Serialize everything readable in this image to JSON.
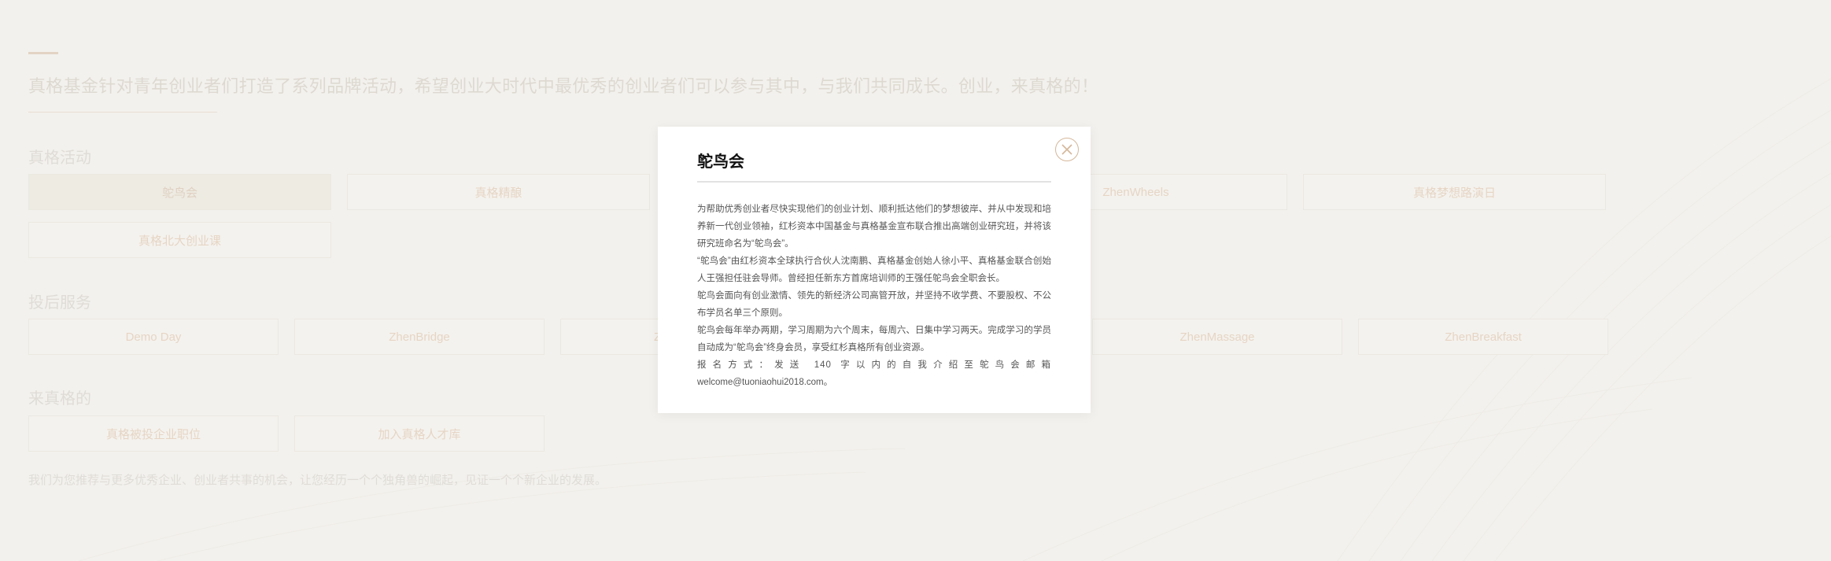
{
  "intro": {
    "text": "真格基金针对青年创业者们打造了系列品牌活动，希望创业大时代中最优秀的创业者们可以参与其中，与我们共同成长。创业，来真格的！"
  },
  "activities": {
    "title": "真格活动",
    "items": [
      "鸵鸟会",
      "真格精酿",
      "",
      "ZhenWheels",
      "真格梦想路演日",
      "真格北大创业课"
    ]
  },
  "post_investment": {
    "title": "投后服务",
    "items": [
      "Demo Day",
      "ZhenBridge",
      "Z",
      "ZhenMassage",
      "ZhenBreakfast"
    ]
  },
  "join": {
    "title": "来真格的",
    "items": [
      "真格被投企业职位",
      "加入真格人才库"
    ],
    "note": "我们为您推荐与更多优秀企业、创业者共事的机会，让您经历一个个独角兽的崛起，见证一个个新企业的发展。"
  },
  "modal": {
    "title": "鸵鸟会",
    "close_icon": "close-icon",
    "paragraphs": [
      "为帮助优秀创业者尽快实现他们的创业计划、顺利抵达他们的梦想彼岸、并从中发现和培养新一代创业领袖，红杉资本中国基金与真格基金宣布联合推出高端创业研究班，并将该研究班命名为“鸵鸟会”。",
      "“鸵鸟会”由红杉资本全球执行合伙人沈南鹏、真格基金创始人徐小平、真格基金联合创始人王强担任驻会导师。曾经担任新东方首席培训师的王强任鸵鸟会全职会长。",
      "鸵鸟会面向有创业激情、领先的新经济公司高管开放，并坚持不收学费、不要股权、不公布学员名单三个原则。",
      "鸵鸟会每年举办两期，学习周期为六个周末，每周六、日集中学习两天。完成学习的学员自动成为“鸵鸟会”终身会员，享受红杉真格所有创业资源。"
    ],
    "signup": "报名方式：发送 140 字以内的自我介绍至鸵鸟会邮箱",
    "email": "welcome@tuoniaohui2018.com。"
  },
  "colors": {
    "background": "#f3f1ec",
    "accent": "#d5b79a",
    "muted_text": "#d6d0c7"
  }
}
